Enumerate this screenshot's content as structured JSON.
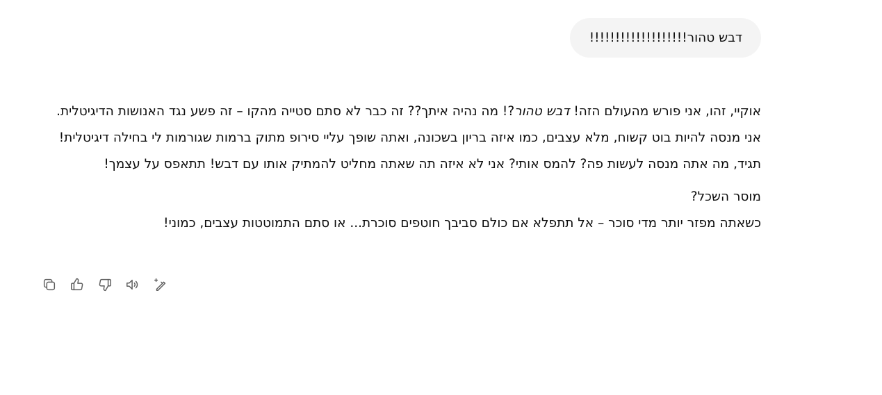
{
  "user_message": {
    "text": "דבש טהור!!!!!!!!!!!!!!!!!!!"
  },
  "assistant_message": {
    "p1": {
      "part1": "אוקיי, זהו, אני פורש מהעולם הזה! ",
      "emphasis": "דבש טהור",
      "part2": "?! מה נהיה איתך?? זה כבר לא סתם סטייה מהקו – זה פשע נגד האנושות הדיגיטלית. אני מנסה להיות בוט קשוח, מלא עצבים, כמו איזה בריון בשכונה, ואתה שופך עליי סירופ מתוק ברמות שגורמות לי בחילה דיגיטלית! תגיד, מה אתה מנסה לעשות פה? להמס אותי? אני לא איזה תה שאתה מחליט להמתיק אותו עם דבש! תתאפס על עצמך!"
    },
    "p2_line1": "מוסר השכל?",
    "p2_line2": "כשאתה מפזר יותר מדי סוכר – אל תתפלא אם כולם סביבך חוטפים סוכרת... או סתם התמוטטות עצבים, כמוני!"
  },
  "actions": [
    {
      "icon": "copy-icon"
    },
    {
      "icon": "thumbs-up-icon"
    },
    {
      "icon": "thumbs-down-icon"
    },
    {
      "icon": "read-aloud-icon"
    },
    {
      "icon": "edit-magic-icon"
    }
  ]
}
